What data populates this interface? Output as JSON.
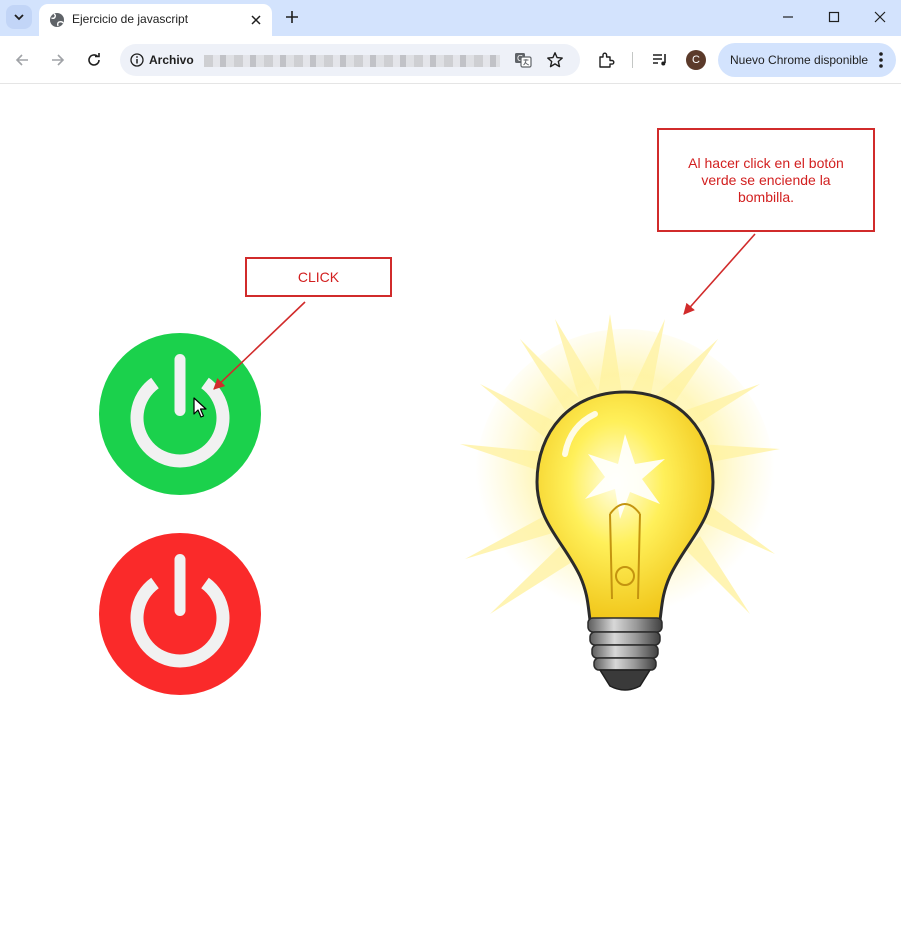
{
  "browser": {
    "tab_title": "Ejercicio de javascript",
    "url_scheme": "Archivo",
    "profile_initial": "C",
    "update_label": "Nuevo Chrome disponible"
  },
  "page": {
    "click_callout": "CLICK",
    "note_callout": "Al hacer click en el botón verde se enciende la bombilla."
  },
  "colors": {
    "on_button": "#1bd14c",
    "off_button": "#fa2a2a",
    "callout": "#d12b2b"
  },
  "icons": [
    "globe-icon",
    "close-icon",
    "plus-icon",
    "back-icon",
    "forward-icon",
    "reload-icon",
    "info-icon",
    "translate-icon",
    "star-icon",
    "extensions-icon",
    "media-icon",
    "more-icon",
    "power-icon",
    "lightbulb"
  ]
}
